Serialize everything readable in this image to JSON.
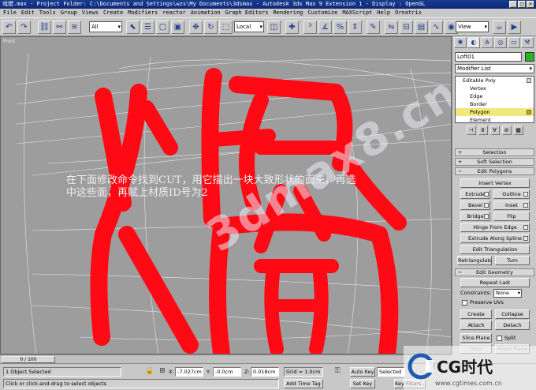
{
  "window": {
    "title": "戏猎.max     - Project Folder: C:\\Documents and Settings\\wzs\\My Documents\\3dsmax     - Autodesk 3ds Max 9 Extension 1     - Display : OpenGL"
  },
  "menu": [
    "File",
    "Edit",
    "Tools",
    "Group",
    "Views",
    "Create",
    "Modifiers",
    "reactor",
    "Animation",
    "Graph Editors",
    "Rendering",
    "Customize",
    "MAXScript",
    "Help",
    "Ornatrix"
  ],
  "toolbar": {
    "filter": "All",
    "coord": "Local",
    "view": "View"
  },
  "viewport": {
    "label": "Front",
    "instruction": "在下面修改命令找到CUT，用它描出一块大致形状的面来，再选中这些面，再赋上材质ID号为2",
    "watermark": "3dmax8.cn",
    "red_color": "#ff0a14",
    "bg_color": "#9d9d9d"
  },
  "cmd": {
    "object_name": "Loft01",
    "modifier_list": "Modifier List",
    "stack": {
      "base": "Editable Poly",
      "items": [
        "Vertex",
        "Edge",
        "Border",
        "Polygon",
        "Element"
      ],
      "selected": "Polygon"
    },
    "rollouts": {
      "selection": "Selection",
      "soft_selection": "Soft Selection",
      "edit_polygons": "Edit Polygons",
      "edit_geometry": "Edit Geometry"
    },
    "edit_polygons": {
      "insert_vertex": "Insert Vertex",
      "extrude": "Extrude",
      "outline": "Outline",
      "bevel": "Bevel",
      "inset": "Inset",
      "bridge": "Bridge",
      "flip": "Flip",
      "hinge": "Hinge From Edge",
      "extrude_spline": "Extrude Along Spline",
      "edit_tri": "Edit Triangulation",
      "retriangulate": "Retriangulate",
      "turn": "Turn"
    },
    "edit_geometry": {
      "repeat_last": "Repeat Last",
      "constraints_label": "Constraints:",
      "constraints_value": "None",
      "preserve_uvs": "Preserve UVs",
      "create": "Create",
      "collapse": "Collapse",
      "attach": "Attach",
      "detach": "Detach",
      "slice_plane": "Slice Plane",
      "split": "Split",
      "slice": "Slice",
      "reset_plane": "Reset Plane"
    }
  },
  "timeline": {
    "frame": "0 / 100"
  },
  "status": {
    "selection": "1 Object Selected",
    "prompt": "Click or click-and-drag to select objects",
    "x_label": "X:",
    "x_value": "-7.027cm",
    "y_label": "Y:",
    "y_value": "-0.0cm",
    "z_label": "Z:",
    "z_value": "0.018cm",
    "grid": "Grid = 1.0cm",
    "add_time_tag": "Add Time Tag",
    "auto_key": "Auto Key",
    "set_key": "Set Key",
    "key_mode": "Selected",
    "key_filters": "Key Filters..."
  },
  "logo": {
    "text": "CG时代",
    "url": "www.cgtimes.com.cn"
  }
}
